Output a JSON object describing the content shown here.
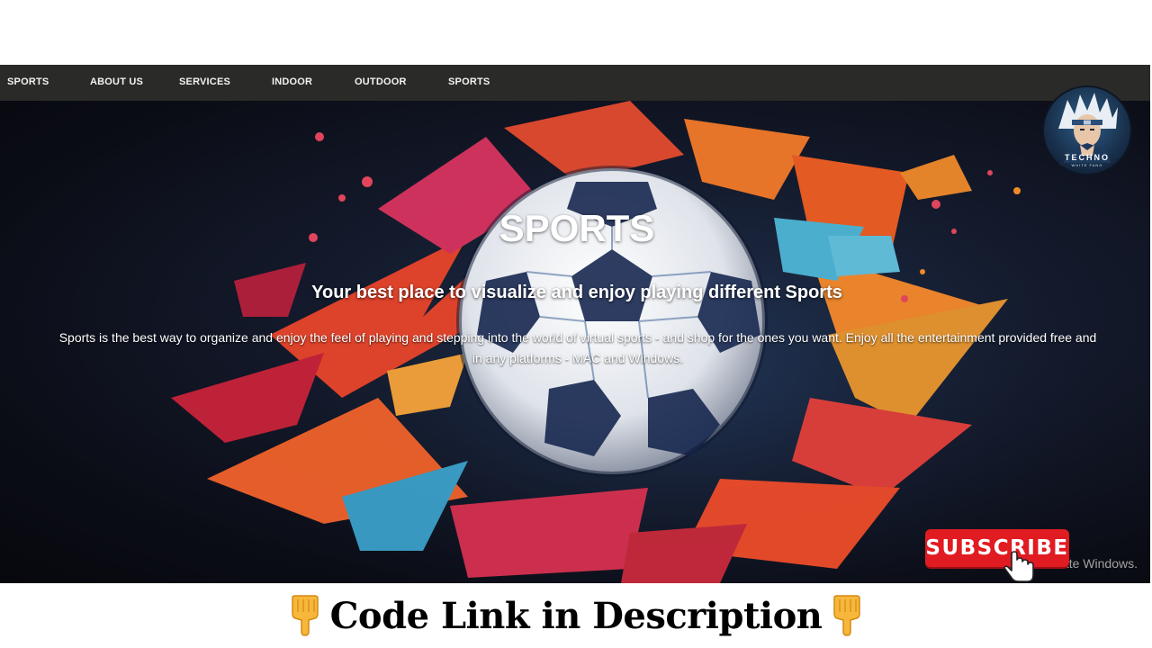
{
  "nav": {
    "items": [
      {
        "label": "SPORTS"
      },
      {
        "label": "ABOUT US"
      },
      {
        "label": "SERVICES"
      },
      {
        "label": "INDOOR"
      },
      {
        "label": "OUTDOOR"
      },
      {
        "label": "SPORTS"
      }
    ]
  },
  "hero": {
    "title": "SPORTS",
    "subtitle": "Your best place to visualize and enjoy playing different Sports",
    "description": "Sports is the best way to organize and enjoy the feel of playing and stepping into the world of virtual sports - and shop for the ones you want. Enjoy all the entertainment provided free and in any platforms - MAC and Windows.",
    "image_icon": "soccer-ball-paint-splash-image"
  },
  "watermark": {
    "text": "Go to Settings to activate Windows."
  },
  "channel_logo": {
    "name": "TECHNO",
    "tagline": "WHITE FANG"
  },
  "subscribe": {
    "label": "SUBSCRIBE"
  },
  "footer": {
    "text": "Code Link in Description",
    "icon": "pointing-down-hand-icon"
  },
  "colors": {
    "navbar_bg": "#2a2a28",
    "subscribe_red": "#e11b22",
    "hero_dark": "#0b0d16"
  }
}
